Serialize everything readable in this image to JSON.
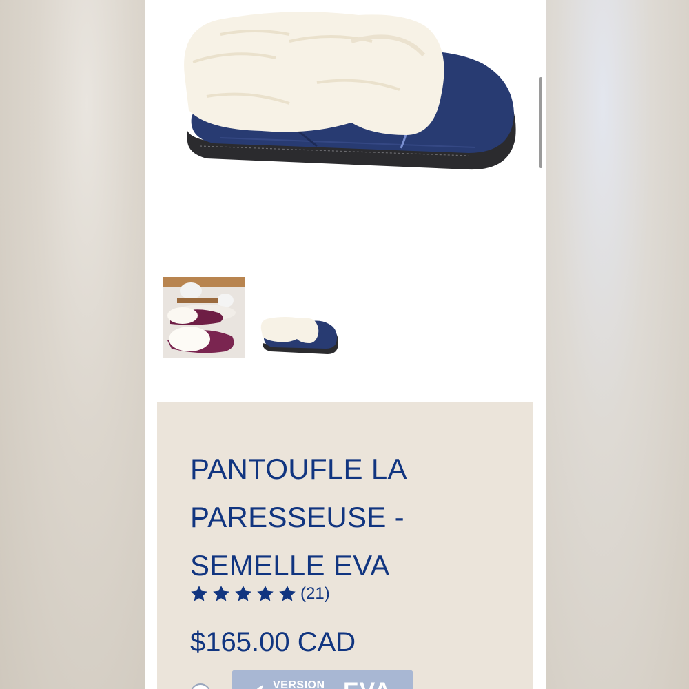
{
  "product": {
    "title_lines": [
      "PANTOUFLE LA",
      "PARESSEUSE -",
      "SEMELLE EVA"
    ],
    "rating": {
      "stars": 5,
      "count_label": "(21)"
    },
    "price": "$165.00 CAD"
  },
  "gallery": {
    "main_image": "navy-suede-sheepskin-slipper-side-view",
    "thumbnails": [
      "burgundy-slippers-lifestyle",
      "navy-slipper-side-view"
    ]
  },
  "variant": {
    "label_small": "VERSION",
    "label_big": "EVA",
    "icon": "feather-icon"
  },
  "colors": {
    "brand_blue": "#113580",
    "panel_bg": "#ebe4da",
    "variant_bg": "#a8b7d3"
  }
}
